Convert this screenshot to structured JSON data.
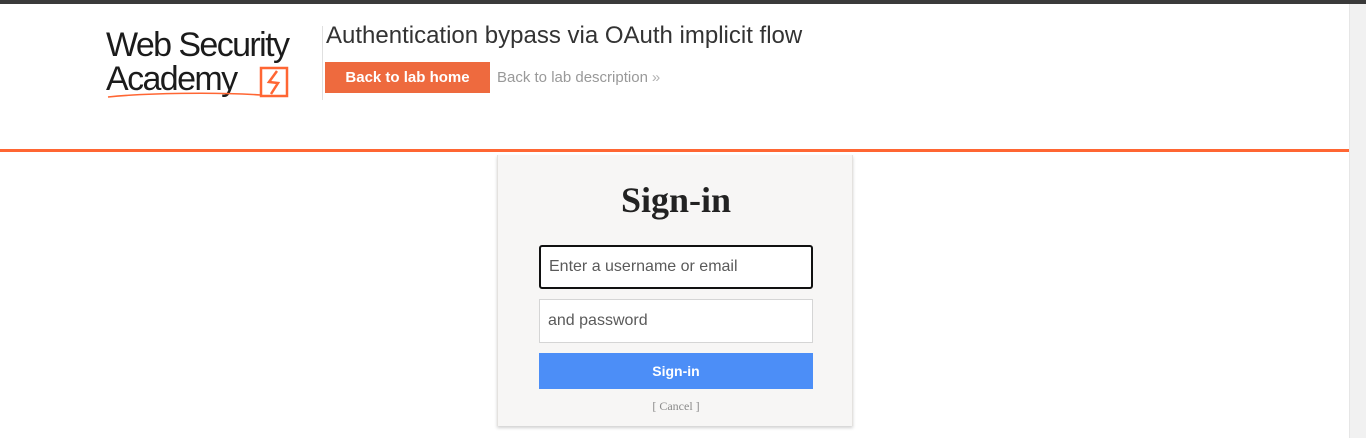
{
  "header": {
    "logo": {
      "line1": "Web Security",
      "line2": "Academy",
      "icon": "lightning-bolt-icon"
    },
    "lab_title": "Authentication bypass via OAuth implicit flow",
    "back_home_label": "Back to lab home",
    "back_description_label": "Back to lab description",
    "back_description_icon": "double-chevron-right-icon",
    "accent_color": "#ff6633"
  },
  "login": {
    "title": "Sign-in",
    "username_placeholder": "Enter a username or email",
    "password_placeholder": "and password",
    "submit_label": "Sign-in",
    "cancel_label": "[ Cancel ]",
    "button_color": "#4c8ef7"
  }
}
